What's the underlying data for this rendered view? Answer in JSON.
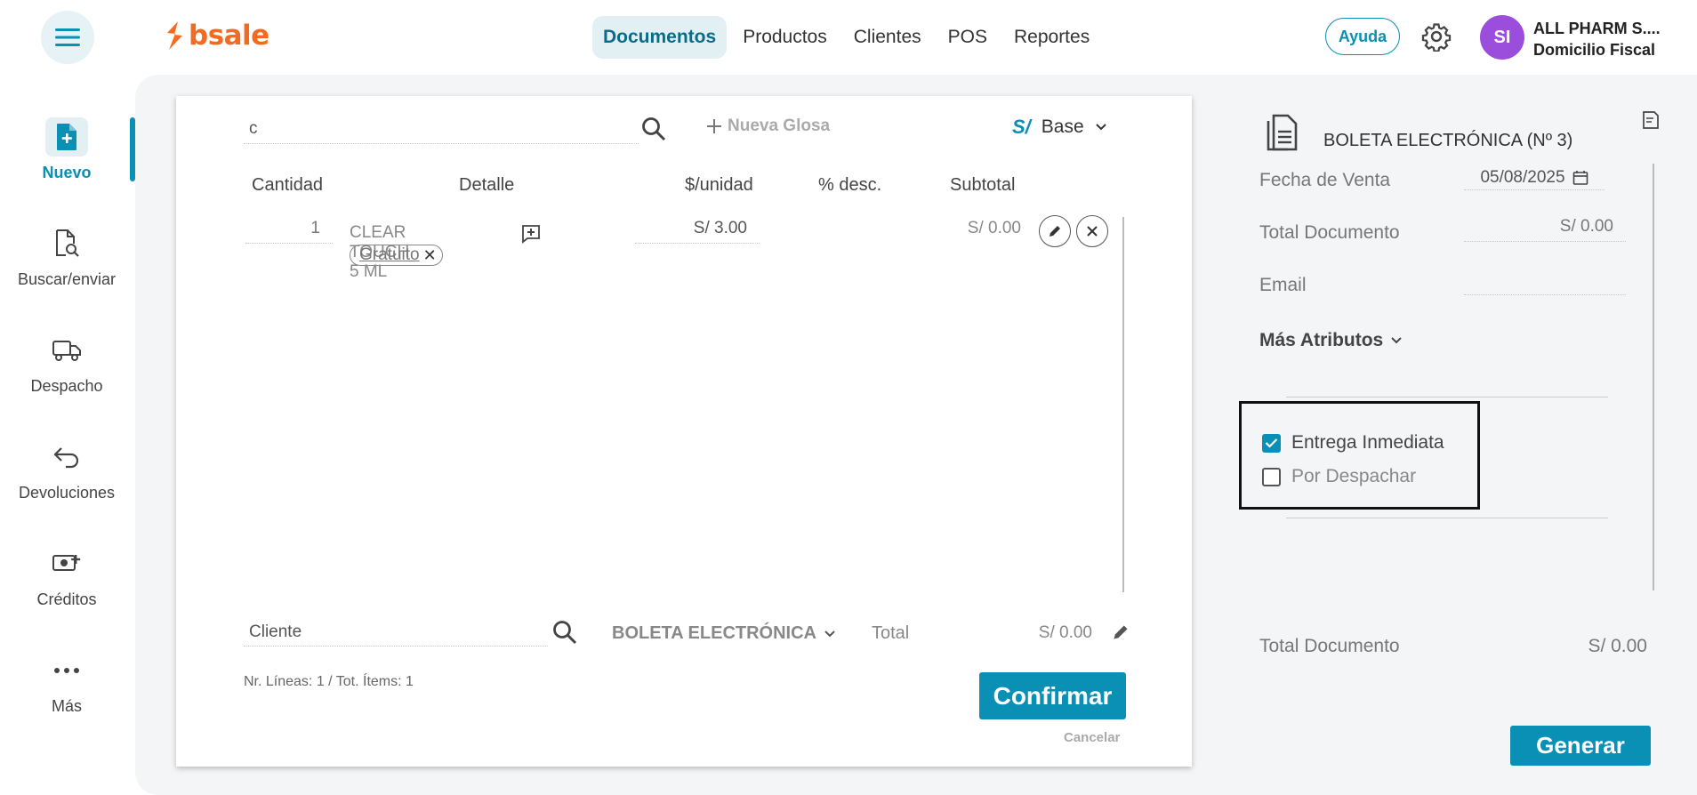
{
  "topbar": {
    "logo_text": "bsale",
    "nav": [
      "Documentos",
      "Productos",
      "Clientes",
      "POS",
      "Reportes"
    ],
    "help_label": "Ayuda",
    "avatar_initials": "SI",
    "company_name": "ALL PHARM S....",
    "company_sub": "Domicilio Fiscal"
  },
  "sidebar": {
    "items": [
      {
        "label": "Nuevo",
        "icon": "new-document-icon"
      },
      {
        "label": "Buscar/enviar",
        "icon": "search-document-icon"
      },
      {
        "label": "Despacho",
        "icon": "truck-icon"
      },
      {
        "label": "Devoluciones",
        "icon": "return-arrow-icon"
      },
      {
        "label": "Créditos",
        "icon": "money-plus-icon"
      },
      {
        "label": "Más",
        "icon": "more-dots-icon"
      }
    ]
  },
  "editor": {
    "search_value": "c",
    "new_glosa_label": "Nueva Glosa",
    "currency_symbol": "S/",
    "price_list": "Base",
    "columns": [
      "Cantidad",
      "Detalle",
      "$/unidad",
      "% desc.",
      "Subtotal"
    ],
    "rows": [
      {
        "qty": "1",
        "detail": "CLEAR TOUCH 5 ML",
        "tag": "Gratuito",
        "unit_price": "S/ 3.00",
        "discount": "",
        "subtotal": "S/ 0.00"
      }
    ],
    "client_placeholder": "Cliente",
    "doc_type": "BOLETA ELECTRÓNICA",
    "total_label": "Total",
    "total_value": "S/ 0.00",
    "line_info": "Nr. Líneas: 1 / Tot. Ítems: 1",
    "confirm_label": "Confirmar",
    "cancel_label": "Cancelar"
  },
  "right_panel": {
    "doc_title": "BOLETA ELECTRÓNICA (Nº 3)",
    "fecha_label": "Fecha de Venta",
    "fecha_value": "05/08/2025",
    "total_doc_label": "Total Documento",
    "total_doc_value": "S/ 0.00",
    "email_label": "Email",
    "email_value": "",
    "more_attrs_label": "Más Atributos",
    "delivery_options": [
      {
        "label": "Entrega Inmediata",
        "checked": true
      },
      {
        "label": "Por Despachar",
        "checked": false
      }
    ],
    "footer_total_label": "Total Documento",
    "footer_total_value": "S/ 0.00",
    "generate_label": "Generar"
  },
  "colors": {
    "brand_orange": "#f36b21",
    "primary_blue": "#0a8fb5",
    "avatar_purple": "#9b4ddb"
  }
}
